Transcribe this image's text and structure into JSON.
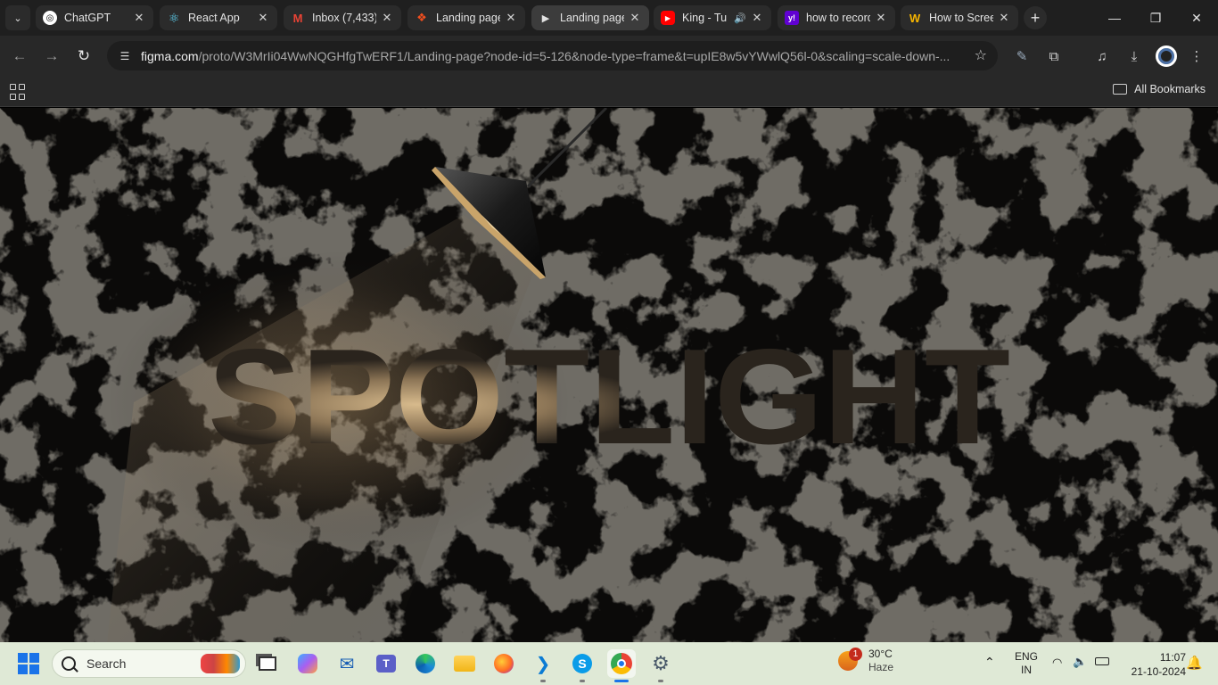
{
  "tabs": [
    {
      "title": "ChatGPT",
      "icon": "openai-icon",
      "fav_bg": "#ffffff",
      "fav_fg": "#000000",
      "glyph": "◎"
    },
    {
      "title": "React App",
      "icon": "react-icon",
      "fav_bg": "transparent",
      "fav_fg": "#61dafb",
      "glyph": "⚛"
    },
    {
      "title": "Inbox (7,433)",
      "icon": "gmail-icon",
      "fav_bg": "transparent",
      "fav_fg": "#ea4335",
      "glyph": "M"
    },
    {
      "title": "Landing page",
      "icon": "figma-icon",
      "fav_bg": "transparent",
      "fav_fg": "#f24e1e",
      "glyph": "❖"
    },
    {
      "title": "Landing page",
      "icon": "figma-play-icon",
      "fav_bg": "transparent",
      "fav_fg": "#e3e3e3",
      "glyph": "▶"
    },
    {
      "title": "King - Tu",
      "icon": "youtube-icon",
      "fav_bg": "#ff0000",
      "fav_fg": "#ffffff",
      "glyph": "▶"
    },
    {
      "title": "how to record",
      "icon": "yahoo-icon",
      "fav_bg": "#6001d2",
      "fav_fg": "#ffffff",
      "glyph": "y!"
    },
    {
      "title": "How to Screen",
      "icon": "wondershare-icon",
      "fav_bg": "transparent",
      "fav_fg": "#f5b400",
      "glyph": "W"
    }
  ],
  "address": {
    "domain": "figma.com",
    "path": "/proto/W3MrIi04WwNQGHfgTwERF1/Landing-page?node-id=5-126&node-type=frame&t=upIE8w5vYWwlQ56l-0&scaling=scale-down-..."
  },
  "bookmarks": {
    "all_label": "All Bookmarks"
  },
  "page": {
    "headline": "SPOTLIGHT"
  },
  "taskbar": {
    "search_placeholder": "Search",
    "weather": {
      "temp": "30°C",
      "condition": "Haze",
      "badge": "1"
    },
    "lang": {
      "line1": "ENG",
      "line2": "IN"
    },
    "clock": {
      "time": "11:07",
      "date": "21-10-2024"
    }
  },
  "colors": {
    "accent": "#1a73e8",
    "headline_lit": "#b49a74",
    "headline_dim": "#2b2620",
    "lamp_rim": "#c9a46a"
  }
}
